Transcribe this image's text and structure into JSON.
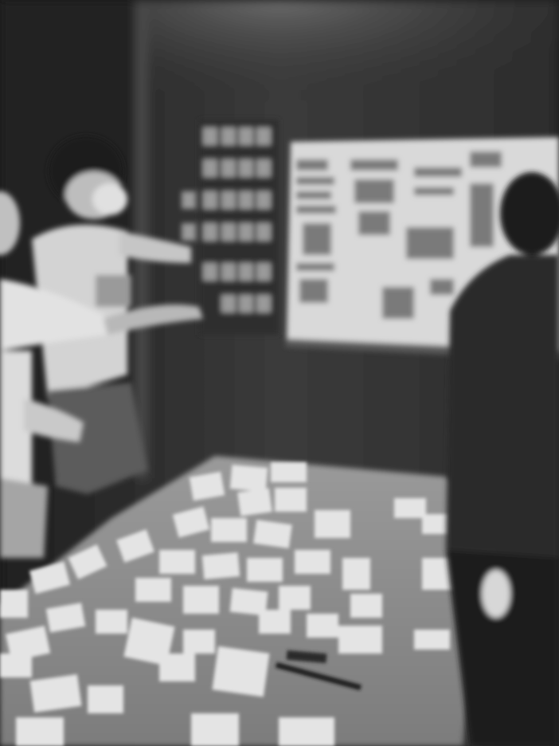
{
  "image": {
    "kind": "photograph",
    "color_mode": "grayscale",
    "subjects": [
      "person-pointing-masked",
      "person-reaching-left",
      "person-at-whiteboard"
    ],
    "objects": [
      "whiteboard",
      "wall-sticky-notes",
      "table",
      "paper-cards",
      "pen"
    ],
    "palette": {
      "wall": "#3a3a3a",
      "wall_dark": "#262626",
      "whiteboard": "#dcdcdc",
      "table": "#8a8a8a",
      "cards": "#e6e6e6",
      "skin": "#c8c8c8",
      "shirt_light": "#d8d8d8",
      "jacket_dark": "#2a2a2a"
    }
  }
}
